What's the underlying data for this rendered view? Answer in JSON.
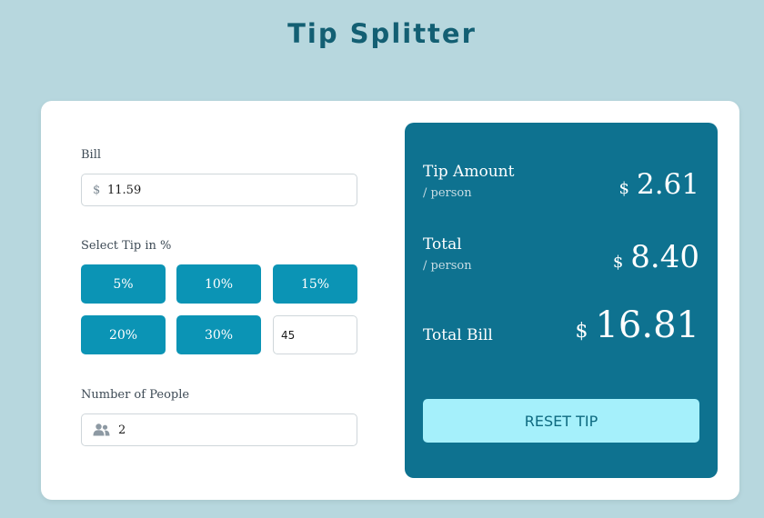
{
  "app": {
    "title": "Tip Splitter"
  },
  "bill": {
    "label": "Bill",
    "currency_symbol": "$",
    "value": "11.59"
  },
  "tip": {
    "label": "Select Tip in %",
    "options": [
      "5%",
      "10%",
      "15%",
      "20%",
      "30%"
    ],
    "custom_value": "45"
  },
  "people": {
    "label": "Number of People",
    "icon": "people-icon",
    "value": "2"
  },
  "results": {
    "tip_amount": {
      "label": "Tip Amount",
      "sub": "/ person",
      "currency": "$",
      "value": "2.61"
    },
    "total": {
      "label": "Total",
      "sub": "/ person",
      "currency": "$",
      "value": "8.40"
    },
    "total_bill": {
      "label": "Total Bill",
      "currency": "$",
      "value": "16.81"
    },
    "reset_label": "RESET TIP"
  },
  "colors": {
    "background": "#b7d7de",
    "title": "#135f73",
    "tip_button": "#0b94b5",
    "result_panel": "#0e7290",
    "reset_button": "#a5f0fb"
  }
}
